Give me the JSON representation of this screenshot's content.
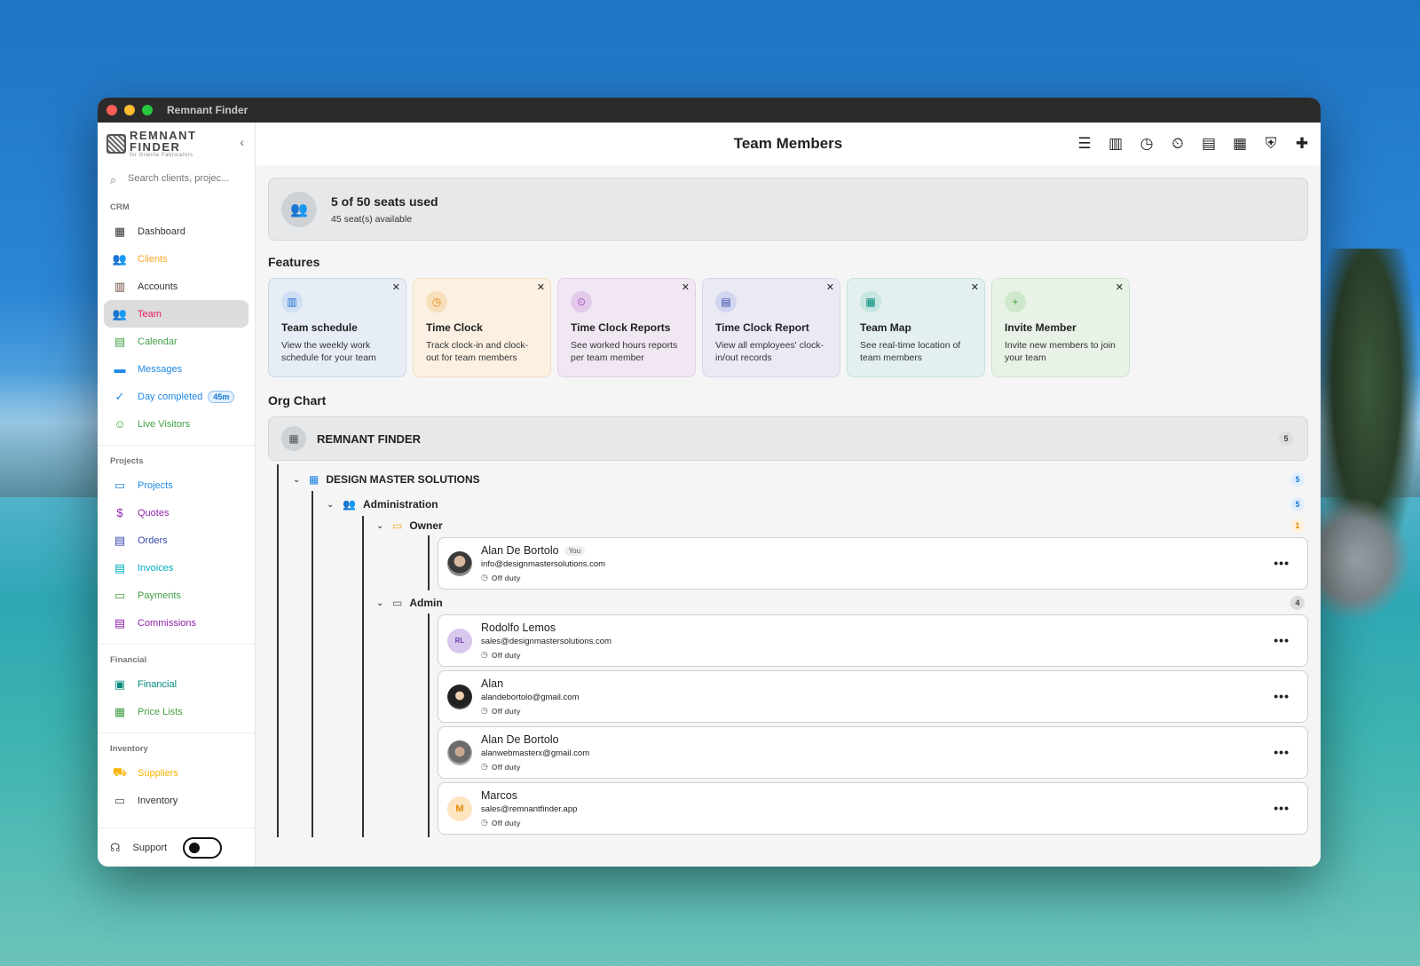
{
  "window": {
    "title": "Remnant Finder"
  },
  "sidebar": {
    "logo": {
      "line1": "REMNANT",
      "line2": "FINDER",
      "line3": "for Granite Fabricators"
    },
    "search": {
      "placeholder": "Search clients, projec..."
    },
    "sections": [
      {
        "label": "CRM",
        "items": [
          {
            "label": "Dashboard",
            "icon": "dashboard-icon",
            "color": "#333333"
          },
          {
            "label": "Clients",
            "icon": "people-icon",
            "color": "#f5a623"
          },
          {
            "label": "Accounts",
            "icon": "building-icon",
            "color": "#6d4c41"
          },
          {
            "label": "Team",
            "icon": "team-icon",
            "color": "#e91e63",
            "active": true
          },
          {
            "label": "Calendar",
            "icon": "calendar-icon",
            "color": "#43a047"
          },
          {
            "label": "Messages",
            "icon": "chat-icon",
            "color": "#1e88e5"
          },
          {
            "label": "Day completed",
            "icon": "check-circle-icon",
            "color": "#1e88e5",
            "badge": "45m"
          },
          {
            "label": "Live Visitors",
            "icon": "visitors-icon",
            "color": "#43a047"
          }
        ]
      },
      {
        "label": "Projects",
        "items": [
          {
            "label": "Projects",
            "icon": "folder-icon",
            "color": "#1e88e5"
          },
          {
            "label": "Quotes",
            "icon": "quote-icon",
            "color": "#8e24aa"
          },
          {
            "label": "Orders",
            "icon": "orders-icon",
            "color": "#3949ab"
          },
          {
            "label": "Invoices",
            "icon": "invoice-icon",
            "color": "#00acc1"
          },
          {
            "label": "Payments",
            "icon": "payments-icon",
            "color": "#43a047"
          },
          {
            "label": "Commissions",
            "icon": "commissions-icon",
            "color": "#8e24aa"
          }
        ]
      },
      {
        "label": "Financial",
        "items": [
          {
            "label": "Financial",
            "icon": "wallet-icon",
            "color": "#00897b"
          },
          {
            "label": "Price Lists",
            "icon": "pricelist-icon",
            "color": "#43a047"
          }
        ]
      },
      {
        "label": "Inventory",
        "items": [
          {
            "label": "Suppliers",
            "icon": "truck-icon",
            "color": "#f5b400"
          },
          {
            "label": "Inventory",
            "icon": "inventory-icon",
            "color": "#555555"
          }
        ]
      }
    ],
    "support": {
      "label": "Support"
    }
  },
  "header": {
    "title": "Team Members",
    "icons": [
      "list-icon",
      "columns-icon",
      "clock-icon",
      "timer-report-icon",
      "clipboard-icon",
      "map-icon",
      "shield-icon",
      "add-person-icon"
    ]
  },
  "seats": {
    "title": "5 of 50 seats used",
    "subtitle": "45 seat(s) available"
  },
  "features": {
    "heading": "Features",
    "cards": [
      {
        "title": "Team schedule",
        "desc": "View the weekly work schedule for your team",
        "theme": "c-blue",
        "icon": "schedule-icon",
        "glyph": "▥"
      },
      {
        "title": "Time Clock",
        "desc": "Track clock-in and clock-out for team members",
        "theme": "c-orange",
        "icon": "clock-icon",
        "glyph": "◷"
      },
      {
        "title": "Time Clock Reports",
        "desc": "See worked hours reports per team member",
        "theme": "c-purple",
        "icon": "timer-report-icon",
        "glyph": "⏲"
      },
      {
        "title": "Time Clock Report",
        "desc": "View all employees' clock-in/out records",
        "theme": "c-indigo",
        "icon": "clipboard-icon",
        "glyph": "▤"
      },
      {
        "title": "Team Map",
        "desc": "See real-time location of team members",
        "theme": "c-teal",
        "icon": "map-icon",
        "glyph": "▦"
      },
      {
        "title": "Invite Member",
        "desc": "Invite new members to join your team",
        "theme": "c-green",
        "icon": "add-person-icon",
        "glyph": "+"
      }
    ]
  },
  "org": {
    "heading": "Org Chart",
    "root": {
      "label": "REMNANT FINDER",
      "count": "5"
    },
    "company": {
      "label": "DESIGN MASTER SOLUTIONS",
      "count": "5"
    },
    "department": {
      "label": "Administration",
      "count": "5"
    },
    "roles": [
      {
        "label": "Owner",
        "count": "1",
        "members": [
          {
            "name": "Alan De Bortolo",
            "you": "You",
            "email": "info@designmastersolutions.com",
            "status": "Off duty",
            "avatar": "av-photo1",
            "initials": ""
          }
        ]
      },
      {
        "label": "Admin",
        "count": "4",
        "members": [
          {
            "name": "Rodolfo Lemos",
            "email": "sales@designmastersolutions.com",
            "status": "Off duty",
            "avatar": "av-rl",
            "initials": "RL"
          },
          {
            "name": "Alan",
            "email": "alandebortolo@gmail.com",
            "status": "Off duty",
            "avatar": "av-photo2",
            "initials": ""
          },
          {
            "name": "Alan De Bortolo",
            "email": "alanwebmasterx@gmail.com",
            "status": "Off duty",
            "avatar": "av-photo3",
            "initials": ""
          },
          {
            "name": "Marcos",
            "email": "sales@remnantfinder.app",
            "status": "Off duty",
            "avatar": "av-m",
            "initials": "M"
          }
        ]
      }
    ]
  }
}
